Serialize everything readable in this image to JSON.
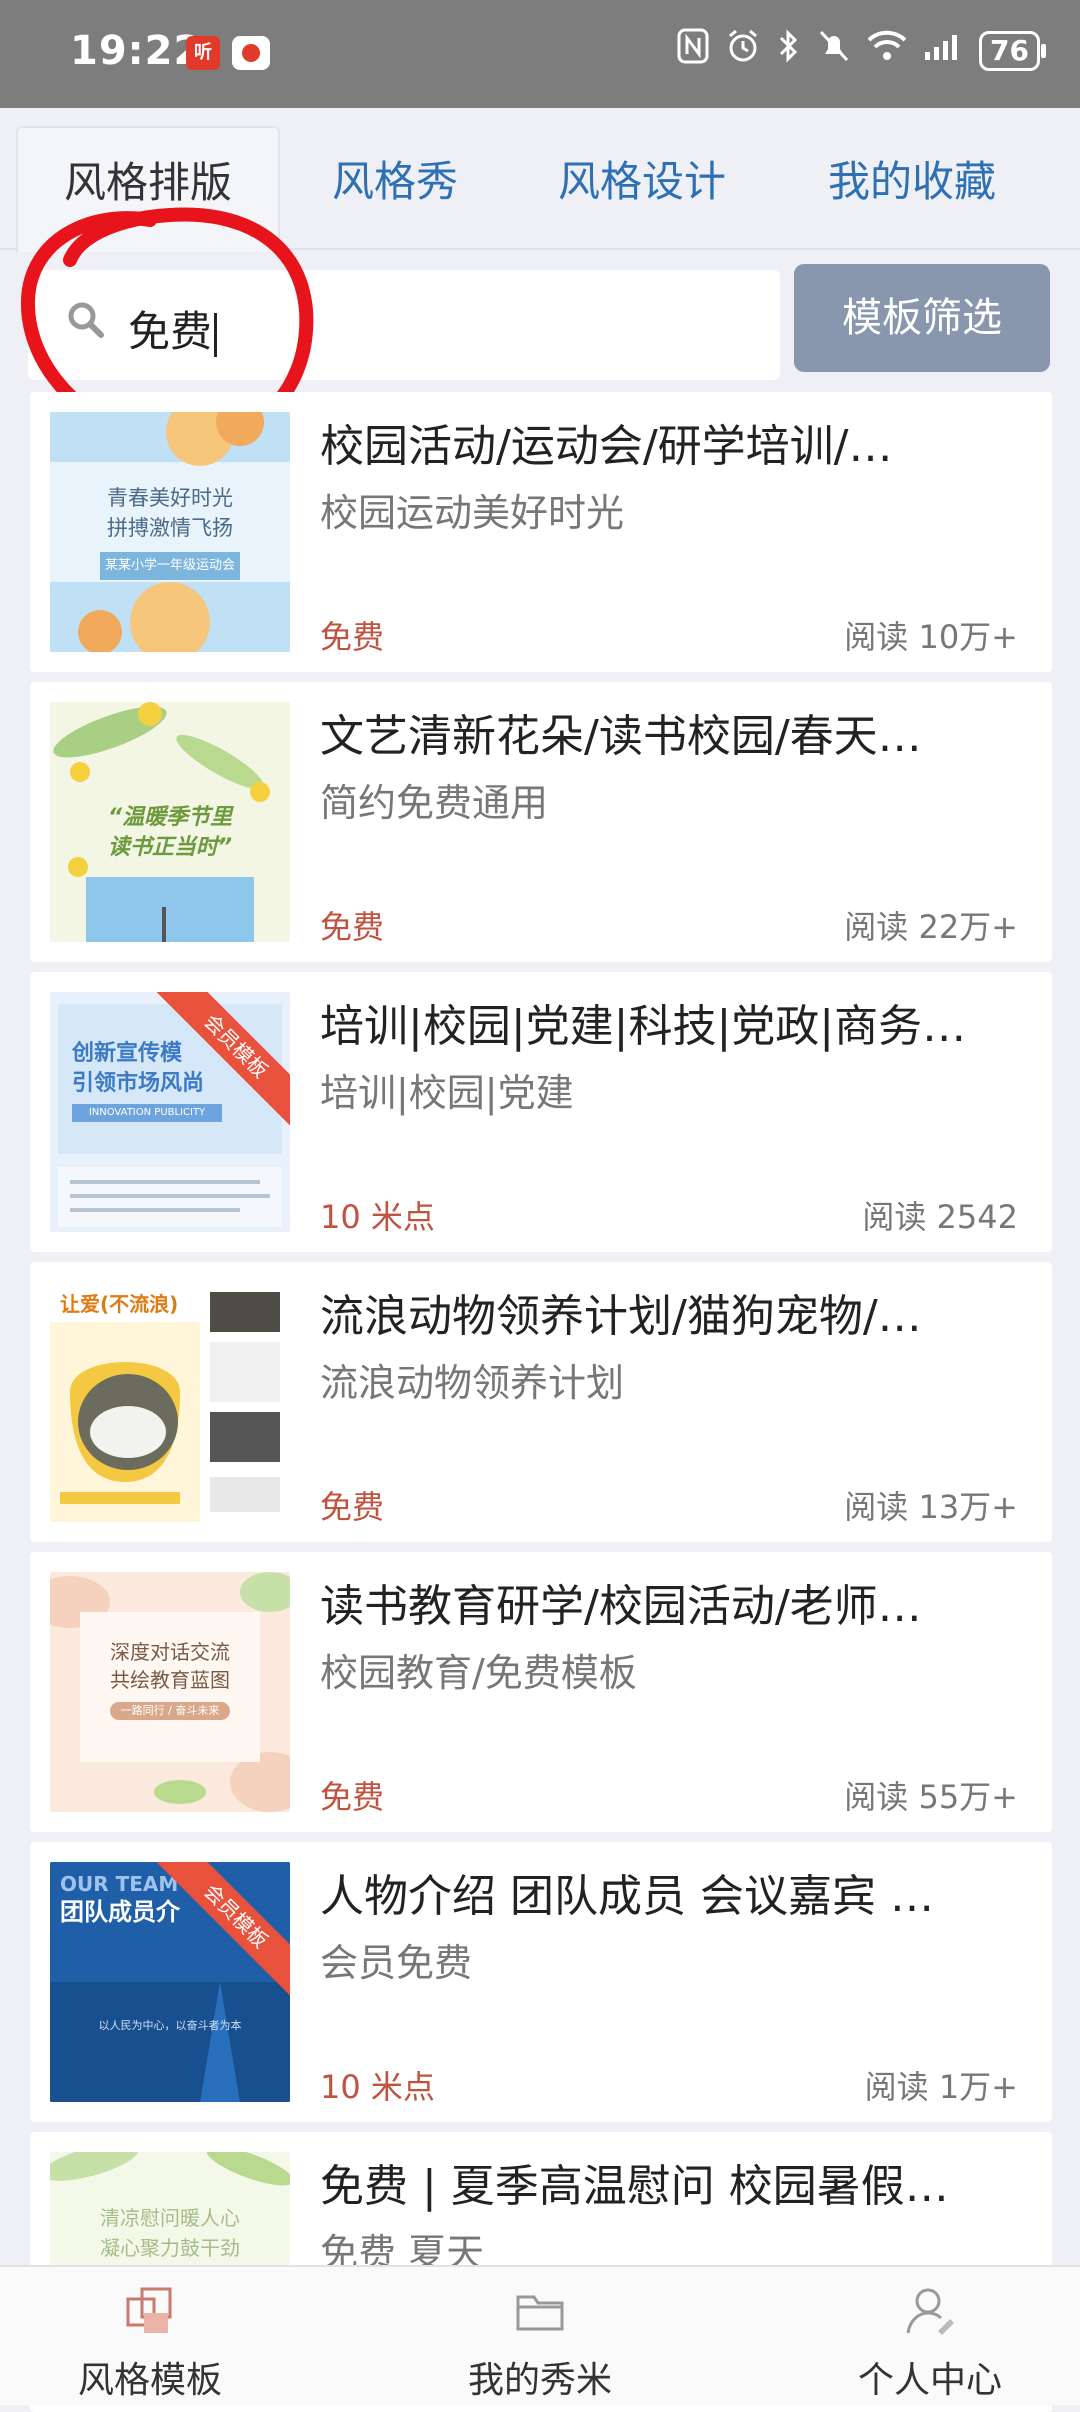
{
  "status_bar": {
    "time": "19:22",
    "app_icon_1": "听",
    "icons": [
      "nfc-icon",
      "alarm-icon",
      "bluetooth-icon",
      "mute-icon",
      "wifi-icon",
      "signal-icon"
    ],
    "battery": "76"
  },
  "tabs": [
    {
      "label": "风格排版",
      "active": true
    },
    {
      "label": "风格秀",
      "active": false
    },
    {
      "label": "风格设计",
      "active": false
    },
    {
      "label": "我的收藏",
      "active": false
    }
  ],
  "search": {
    "value": "免费",
    "filter_label": "模板筛选"
  },
  "cards": [
    {
      "title": "校园活动/运动会/研学培训/…",
      "subtitle": "校园运动美好时光",
      "price": "免费",
      "reads": "阅读 10万+",
      "thumb_lines": [
        "青春美好时光",
        "拼搏激情飞扬"
      ],
      "thumb_caption": "某某小学一年级运动会",
      "member": false
    },
    {
      "title": "文艺清新花朵/读书校园/春天…",
      "subtitle": "简约免费通用",
      "price": "免费",
      "reads": "阅读 22万+",
      "thumb_lines": [
        "“温暖季节里",
        "读书正当时”"
      ],
      "thumb_caption": "",
      "member": false
    },
    {
      "title": "培训|校园|党建|科技|党政|商务…",
      "subtitle": "培训|校园|党建",
      "price": "10 米点",
      "reads": "阅读 2542",
      "thumb_lines": [
        "创新宣传模",
        "引领市场风尚"
      ],
      "thumb_caption": "INNOVATION PUBLICITY",
      "member": true,
      "member_label": "会员模板"
    },
    {
      "title": "流浪动物领养计划/猫狗宠物/…",
      "subtitle": "流浪动物领养计划",
      "price": "免费",
      "reads": "阅读 13万+",
      "thumb_lines": [
        "让爱(不流浪)"
      ],
      "thumb_caption": "",
      "member": false
    },
    {
      "title": "读书教育研学/校园活动/老师…",
      "subtitle": "校园教育/免费模板",
      "price": "免费",
      "reads": "阅读 55万+",
      "thumb_lines": [
        "深度对话交流",
        "共绘教育蓝图"
      ],
      "thumb_caption": "一路同行 / 奋斗未来",
      "member": false
    },
    {
      "title": "人物介绍 团队成员 会议嘉宾 …",
      "subtitle": "会员免费",
      "price": "10 米点",
      "reads": "阅读 1万+",
      "thumb_lines": [
        "OUR TEAM",
        "团队成员介"
      ],
      "thumb_caption": "以人民为中心，以奋斗者为本",
      "member": true,
      "member_label": "会员模板"
    },
    {
      "title": "免费 | 夏季高温慰问 校园暑假…",
      "subtitle": "免费 夏天",
      "price": "",
      "reads": "",
      "thumb_lines": [
        "清凉慰问暖人心",
        "凝心聚力鼓干劲"
      ],
      "thumb_caption": "",
      "member": false
    }
  ],
  "bottom_nav": [
    {
      "label": "风格模板",
      "icon": "template-icon"
    },
    {
      "label": "我的秀米",
      "icon": "folder-icon"
    },
    {
      "label": "个人中心",
      "icon": "user-icon"
    }
  ],
  "colors": {
    "tab_blue": "#2f6fb4",
    "price_red": "#c0523f",
    "filter_button": "#8897ae",
    "annotation_red": "#e8141b"
  }
}
